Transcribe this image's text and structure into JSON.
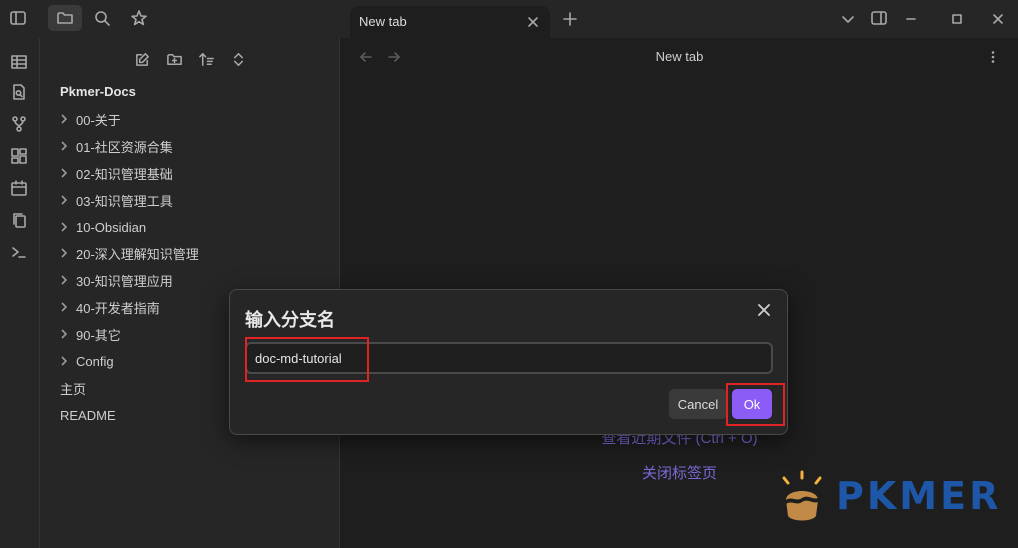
{
  "titlebar": {
    "tab_title": "New tab"
  },
  "view": {
    "title": "New tab"
  },
  "sidebar": {
    "vault_name": "Pkmer-Docs",
    "folders": [
      "00-关于",
      "01-社区资源合集",
      "02-知识管理基础",
      "03-知识管理工具",
      "10-Obsidian",
      "20-深入理解知识管理",
      "30-知识管理应用",
      "40-开发者指南",
      "90-其它",
      "Config"
    ],
    "files": [
      "主页",
      "README"
    ]
  },
  "empty_state": {
    "recent_files": "查看近期文件 (Ctrl + O)",
    "close_tab": "关闭标签页"
  },
  "modal": {
    "title": "输入分支名",
    "input_value": "doc-md-tutorial",
    "cancel_label": "Cancel",
    "ok_label": "Ok"
  },
  "watermark": {
    "text": "PKMER"
  },
  "colors": {
    "accent": "#8b5cf6",
    "link": "#7a68d6",
    "highlight": "#e02424",
    "watermark": "#1e57a8"
  },
  "icons": {
    "titlebar_left": [
      "sidebar-toggle-icon",
      "folder-icon",
      "search-icon",
      "star-icon"
    ],
    "ribbon": [
      "table-icon",
      "file-search-icon",
      "git-branch-icon",
      "dashboard-icon",
      "calendar-icon",
      "copy-icon",
      "terminal-icon"
    ],
    "explorer": [
      "new-note-icon",
      "new-folder-icon",
      "sort-icon",
      "collapse-icon"
    ]
  }
}
